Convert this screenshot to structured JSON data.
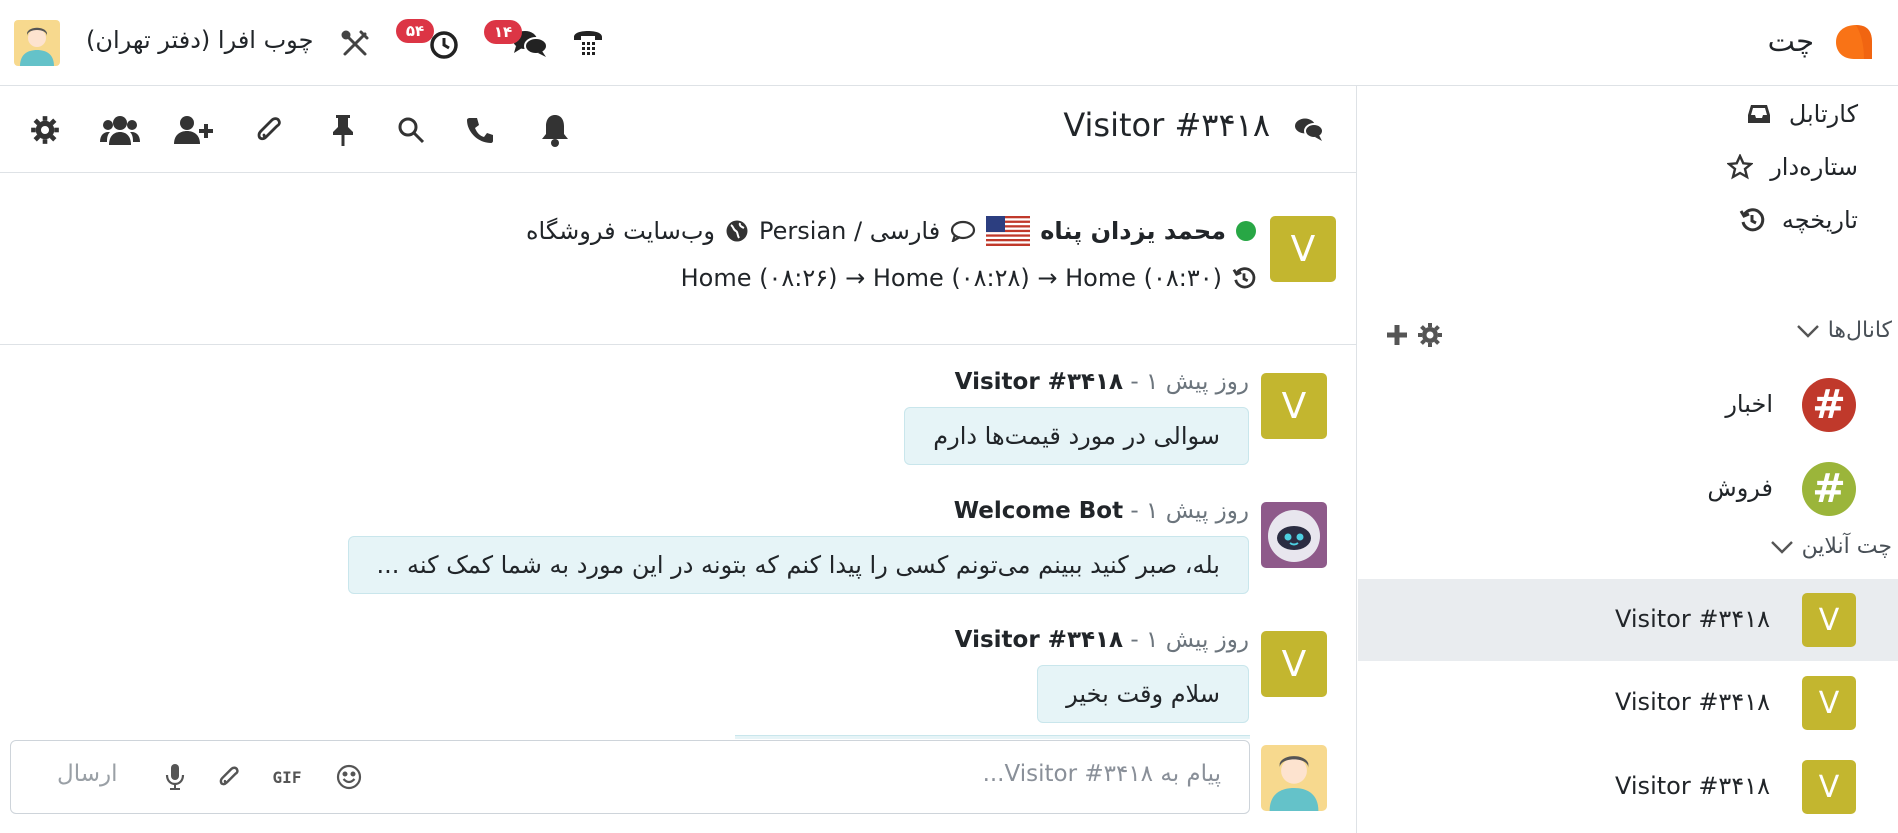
{
  "app": {
    "name": "چت",
    "company": "چوب افرا (دفتر تهران)",
    "activity_badge": "۵۴",
    "messages_badge": "۱۴",
    "accent": "#f97316"
  },
  "sidebar": {
    "inbox": "کارتابل",
    "starred": "ستاره‌دار",
    "history": "تاریخچه",
    "channels_header": "کانال‌ها",
    "channels": [
      {
        "name": "اخبار",
        "color": "#c0392b"
      },
      {
        "name": "فروش",
        "color": "#9bb53a"
      }
    ],
    "livechat_header": "چت آنلاین",
    "livechats": [
      {
        "label": "Visitor #۳۴۱۸",
        "initial": "V",
        "active": true
      },
      {
        "label": "Visitor #۳۴۱۸",
        "initial": "V",
        "active": false
      },
      {
        "label": "Visitor #۳۴۱۸",
        "initial": "V",
        "active": false
      }
    ]
  },
  "thread": {
    "title": "Visitor #۳۴۱۸",
    "visitor": {
      "initial": "V",
      "name": "محمد یزدان پناه",
      "language": "Persian / فارسی",
      "website": "وب‌سایت فروشگاه",
      "history": "Home (۰۸:۲۶) → Home (۰۸:۲۸) → Home (۰۸:۳۰)"
    },
    "messages": [
      {
        "author": "Visitor #۳۴۱۸",
        "date": " - ۱ روز پیش",
        "text": "سوالی در مورد قیمت‌ها دارم",
        "avatar": "V"
      },
      {
        "author": "Welcome Bot",
        "date": " - ۱ روز پیش",
        "text": "بله، صبر کنید ببینم می‌تونم کسی را پیدا کنم که بتونه در این مورد به شما کمک کنه ...",
        "avatar": "bot"
      },
      {
        "author": "Visitor #۳۴۱۸",
        "date": " - ۱ روز پیش",
        "text": "سلام وقت بخیر",
        "avatar": "V"
      }
    ]
  },
  "composer": {
    "placeholder": "پیام به Visitor #۳۴۱۸...",
    "send_label": "ارسال",
    "gif_label": "GIF"
  },
  "colors": {
    "visitor_avatar": "#c3b62f",
    "bubble": "#e6f4f7",
    "badge": "#dc3545",
    "online": "#28a745"
  }
}
